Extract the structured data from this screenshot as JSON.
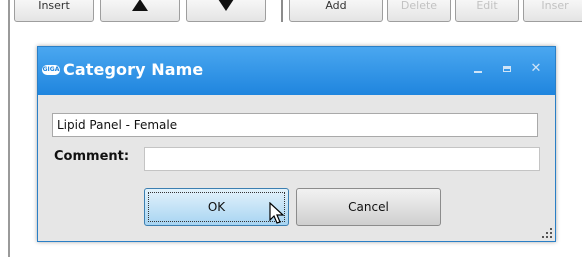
{
  "toolbar": {
    "insert_label": "Insert",
    "add_label": "Add",
    "delete_label": "Delete",
    "edit_label": "Edit",
    "insert2_label": "Inser"
  },
  "dialog": {
    "logo_text": "GIGA",
    "title": "Category Name",
    "name_value": "Lipid Panel - Female",
    "comment_label": "Comment:",
    "comment_value": "",
    "ok_label": "OK",
    "cancel_label": "Cancel"
  },
  "colors": {
    "titlebar": "#2f92e6",
    "dialog_bg": "#e6e6e6",
    "ok_button": "#a7d4f2"
  },
  "icons": {
    "minimize": "minimize-icon",
    "maximize": "maximize-icon",
    "close": "close-icon",
    "up": "arrow-up-icon",
    "down": "arrow-down-icon",
    "cursor": "mouse-pointer-icon",
    "resize": "resize-grip-icon"
  }
}
